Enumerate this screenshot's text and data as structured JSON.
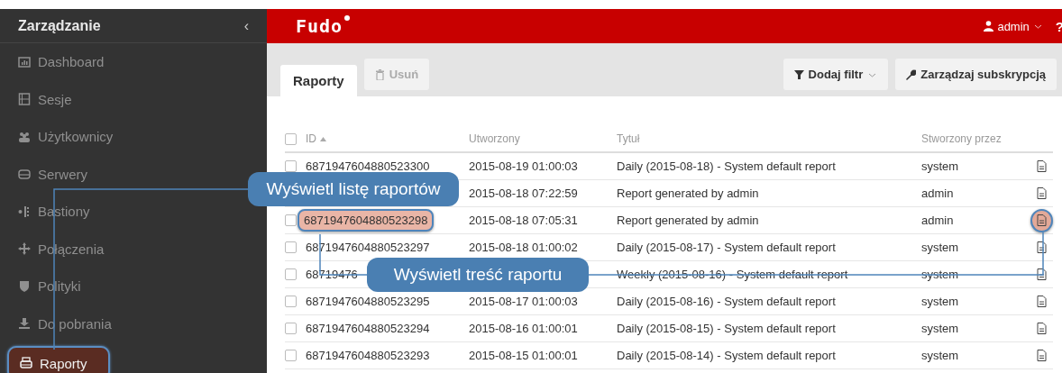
{
  "sidebar": {
    "title": "Zarządzanie",
    "collapse": "‹",
    "items": [
      {
        "label": "Dashboard",
        "selected": false
      },
      {
        "label": "Sesje",
        "selected": false
      },
      {
        "label": "Użytkownicy",
        "selected": false
      },
      {
        "label": "Serwery",
        "selected": false
      },
      {
        "label": "Bastiony",
        "selected": false
      },
      {
        "label": "Połączenia",
        "selected": false
      },
      {
        "label": "Polityki",
        "selected": false
      },
      {
        "label": "Do pobrania",
        "selected": false
      },
      {
        "label": "Raporty",
        "selected": true
      }
    ]
  },
  "header": {
    "logo": "Fudo",
    "user": "admin",
    "help": "?"
  },
  "toolbar": {
    "tabs": [
      {
        "label": "Raporty",
        "selected": true
      }
    ],
    "delete_button": {
      "label": "Usuń",
      "disabled": true
    },
    "filter_button": "Dodaj filtr",
    "subscription_button": "Zarządzaj subskrypcją"
  },
  "table": {
    "select_all_checked": false,
    "columns": [
      "ID",
      "Utworzony",
      "Tytuł",
      "Stworzony przez"
    ],
    "rows": [
      {
        "id": "6871947604880523300",
        "created": "2015-08-19 01:00:03",
        "title": "Daily (2015-08-18) - System default report",
        "author": "system",
        "highlighted": false,
        "checked": false
      },
      {
        "created": "2015-08-18 07:22:59",
        "title": "Report generated by admin",
        "author": "admin",
        "highlighted": false
      },
      {
        "id": "6871947604880523298",
        "created": "2015-08-18 07:05:31",
        "title": "Report generated by admin",
        "author": "admin",
        "highlighted": true,
        "checked": false
      },
      {
        "id": "6871947604880523297",
        "created": "2015-08-18 01:00:02",
        "title": "Daily (2015-08-17) - System default report",
        "author": "system",
        "highlighted": false,
        "checked": false
      },
      {
        "id": "68719476",
        "title": "Weekly (2015-08-16) - System default report",
        "author": "system",
        "highlighted": false,
        "checked": false
      },
      {
        "id": "6871947604880523295",
        "created": "2015-08-17 01:00:03",
        "title": "Daily (2015-08-16) - System default report",
        "author": "system",
        "highlighted": false,
        "checked": false
      },
      {
        "id": "6871947604880523294",
        "created": "2015-08-16 01:00:01",
        "title": "Daily (2015-08-15) - System default report",
        "author": "system",
        "highlighted": false,
        "checked": false
      },
      {
        "id": "6871947604880523293",
        "created": "2015-08-15 01:00:01",
        "title": "Daily (2015-08-14) - System default report",
        "author": "system",
        "highlighted": false,
        "checked": false
      }
    ]
  },
  "callouts": [
    {
      "text": "Wyświetl listę raportów",
      "kind": "list"
    },
    {
      "text": "Wyświetl treść raportu",
      "kind": "content"
    }
  ]
}
